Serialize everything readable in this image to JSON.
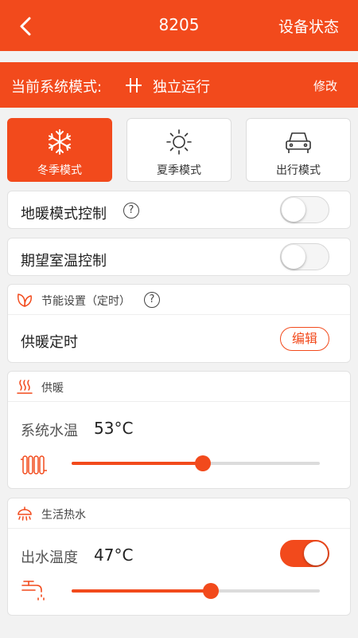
{
  "colors": {
    "accent": "#f24a1c",
    "toggle_off": "#f5f5f5"
  },
  "header": {
    "title": "8205",
    "right_action": "设备状态",
    "back_icon": "chevron-left-icon"
  },
  "mode_bar": {
    "label": "当前系统模式:",
    "icon": "independent-mode-icon",
    "value": "独立运行",
    "edit": "修改"
  },
  "seasons": [
    {
      "label": "冬季模式",
      "icon": "snowflake-icon",
      "active": true
    },
    {
      "label": "夏季模式",
      "icon": "sun-icon",
      "active": false
    },
    {
      "label": "出行模式",
      "icon": "car-icon",
      "active": false
    }
  ],
  "floor_heating": {
    "label": "地暖模式控制",
    "help": "?",
    "on": false
  },
  "room_temp": {
    "label": "期望室温控制",
    "on": false
  },
  "energy": {
    "title": "节能设置（定时）",
    "help": "?",
    "row_label": "供暖定时",
    "edit": "编辑"
  },
  "heating": {
    "title": "供暖",
    "temp_label": "系统水温",
    "temp_value": "53°C",
    "slider_level": 0.53
  },
  "hot_water": {
    "title": "生活热水",
    "temp_label": "出水温度",
    "temp_value": "47°C",
    "on": true,
    "slider_level": 0.56
  }
}
